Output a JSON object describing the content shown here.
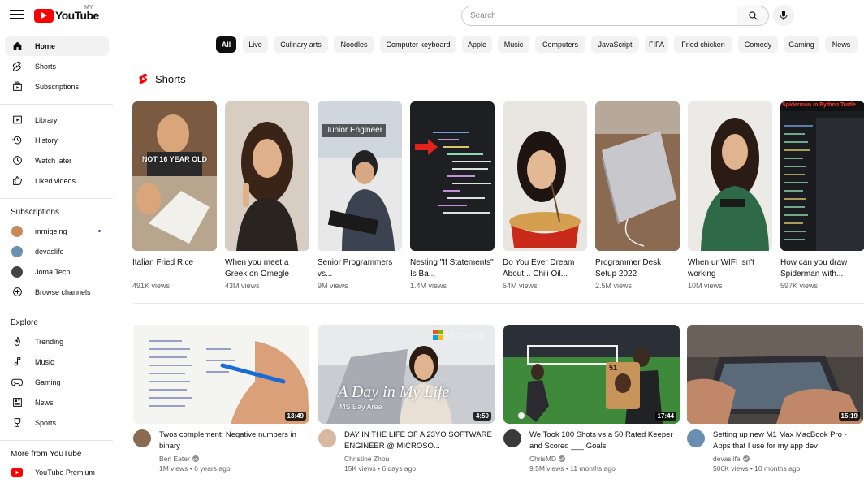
{
  "header": {
    "logo_text": "YouTube",
    "region": "MY",
    "search_placeholder": "Search"
  },
  "sidebar": {
    "main": [
      {
        "label": "Home",
        "icon": "home-icon",
        "active": true
      },
      {
        "label": "Shorts",
        "icon": "shorts-icon"
      },
      {
        "label": "Subscriptions",
        "icon": "subscriptions-icon"
      }
    ],
    "library": [
      {
        "label": "Library",
        "icon": "library-icon"
      },
      {
        "label": "History",
        "icon": "history-icon"
      },
      {
        "label": "Watch later",
        "icon": "watch-later-icon"
      },
      {
        "label": "Liked videos",
        "icon": "liked-icon"
      }
    ],
    "subscriptions_heading": "Subscriptions",
    "subscriptions": [
      {
        "label": "mrnigelng",
        "color": "#c98a5a",
        "live": true
      },
      {
        "label": "devaslife",
        "color": "#6a8fb0"
      },
      {
        "label": "Joma Tech",
        "color": "#444444"
      },
      {
        "label": "Browse channels",
        "icon": "browse-channels-icon"
      }
    ],
    "explore_heading": "Explore",
    "explore": [
      {
        "label": "Trending",
        "icon": "trending-icon"
      },
      {
        "label": "Music",
        "icon": "music-icon"
      },
      {
        "label": "Gaming",
        "icon": "gaming-icon"
      },
      {
        "label": "News",
        "icon": "news-icon"
      },
      {
        "label": "Sports",
        "icon": "sports-icon"
      }
    ],
    "more_heading": "More from YouTube",
    "more": [
      {
        "label": "YouTube Premium",
        "icon": "youtube-premium-icon"
      }
    ]
  },
  "chips": [
    "All",
    "Live",
    "Culinary arts",
    "Noodles",
    "Computer keyboard",
    "Apple",
    "Music",
    "Computers",
    "JavaScript",
    "FIFA",
    "Fried chicken",
    "Comedy",
    "Gaming",
    "News"
  ],
  "shorts": {
    "heading": "Shorts",
    "items": [
      {
        "title": "Italian Fried Rice",
        "views": "491K views",
        "overlay": "NOT 16 YEAR OLD"
      },
      {
        "title": "When you meet a Greek on Omegle",
        "views": "43M views"
      },
      {
        "title": "Senior Programmers vs...",
        "views": "9M views",
        "overlay": "Junior Engineer"
      },
      {
        "title": "Nesting \"If Statements\" Is Ba...",
        "views": "1.4M views"
      },
      {
        "title": "Do You Ever Dream About... Chili Oil...",
        "views": "54M views"
      },
      {
        "title": "Programmer Desk Setup 2022",
        "views": "2.5M views"
      },
      {
        "title": "When ur WIFI isn't working",
        "views": "10M views"
      },
      {
        "title": "How can you draw Spiderman with...",
        "views": "597K views",
        "overlay": "Spiderman in Python Turtle"
      }
    ]
  },
  "videos": [
    {
      "title": "Twos complement: Negative numbers in binary",
      "channel": "Ben Eater",
      "verified": true,
      "views": "1M views",
      "age": "6 years ago",
      "duration": "13:49",
      "avatar": "#8a6a50"
    },
    {
      "title": "DAY IN THE LIFE OF A 23YO SOFTWARE ENGINEER @ MICROSO...",
      "channel": "Christine Zhou",
      "verified": false,
      "views": "15K views",
      "age": "6 days ago",
      "duration": "4:50",
      "avatar": "#d8b8a0",
      "thumb_title": "A Day in My Life",
      "thumb_sub": "MS Bay Area",
      "thumb_brand": "Microsoft"
    },
    {
      "title": "We Took 100 Shots vs a 50 Rated Keeper and Scored ___ Goals",
      "channel": "ChrisMD",
      "verified": true,
      "views": "9.5M views",
      "age": "11 months ago",
      "duration": "17:44",
      "avatar": "#3a3a3a",
      "thumb_card": "51"
    },
    {
      "title": "Setting up new M1 Max MacBook Pro - Apps that I use for my app dev",
      "channel": "devaslife",
      "verified": true,
      "views": "506K views",
      "age": "10 months ago",
      "duration": "15:19",
      "avatar": "#6a8fb0"
    }
  ]
}
